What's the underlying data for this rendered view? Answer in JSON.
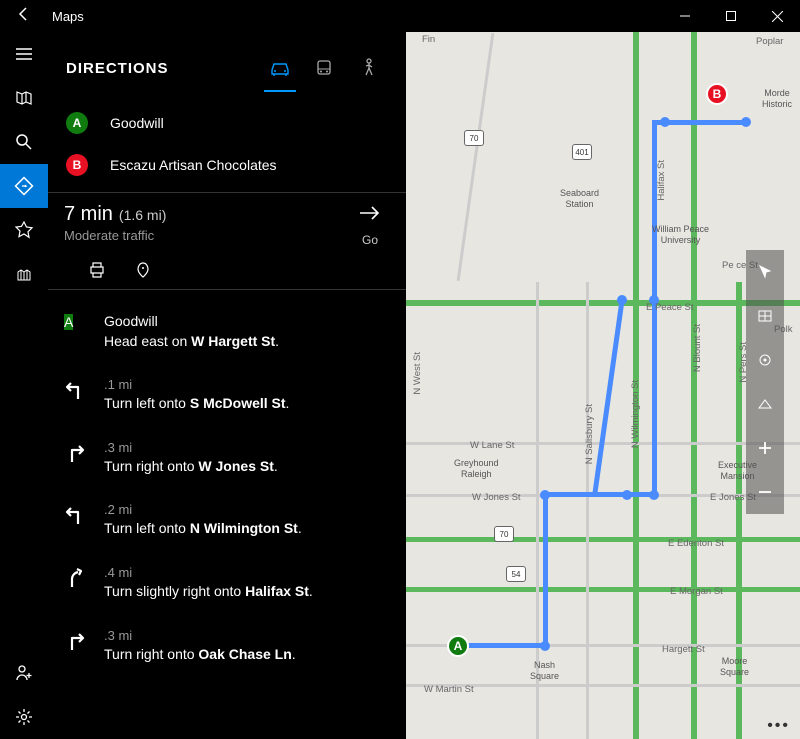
{
  "titlebar": {
    "title": "Maps"
  },
  "panel": {
    "title": "DIRECTIONS"
  },
  "modes": {
    "drive": "car-icon",
    "transit": "bus-icon",
    "walk": "walk-icon"
  },
  "endpoints": {
    "a": {
      "letter": "A",
      "label": "Goodwill"
    },
    "b": {
      "letter": "B",
      "label": "Escazu Artisan Chocolates"
    }
  },
  "summary": {
    "time": "7 min",
    "distance": "(1.6 mi)",
    "traffic": "Moderate traffic",
    "go": "Go"
  },
  "steps": [
    {
      "kind": "start",
      "title": "Goodwill",
      "instr_pre": "Head east on ",
      "road": "W Hargett St",
      "instr_post": "."
    },
    {
      "kind": "left",
      "dist": ".1 mi",
      "instr_pre": "Turn left onto ",
      "road": "S McDowell St",
      "instr_post": "."
    },
    {
      "kind": "right",
      "dist": ".3 mi",
      "instr_pre": "Turn right onto ",
      "road": "W Jones St",
      "instr_post": "."
    },
    {
      "kind": "left",
      "dist": ".2 mi",
      "instr_pre": "Turn left onto ",
      "road": "N Wilmington St",
      "instr_post": "."
    },
    {
      "kind": "slight_right",
      "dist": ".4 mi",
      "instr_pre": "Turn slightly right onto ",
      "road": "Halifax St",
      "instr_post": "."
    },
    {
      "kind": "right",
      "dist": ".3 mi",
      "instr_pre": "Turn right onto ",
      "road": "Oak Chase Ln",
      "instr_post": "."
    }
  ],
  "map": {
    "labels": {
      "fin": "Fin",
      "poplar": "Poplar",
      "morde": "Morde\nHistoric",
      "seaboard": "Seaboard\nStation",
      "wpeace_u": "William Peace\nUniversity",
      "peace_st": "Pe       ce St",
      "e_peace": "E  Peace  St",
      "polk": "Polk",
      "n_west": "N  West  St",
      "w_lane": "W  Lane  St",
      "greyhound": "Greyhound\nRaleigh",
      "w_jones": "W   Jones    St",
      "e_jones": "E  Jones St",
      "salisbury": "N Salisbury St",
      "wilmington": "N  Wilmington  St",
      "halifax": "Halifax  St",
      "n_blount": "N  Blount  St",
      "n_pers": "N  Pers       St",
      "exec": "Executive\nMansion",
      "e_edenton": "E  Edenton  St",
      "e_morgan": "E  Morgan  St",
      "hargett": "Hargett  St",
      "w_martin": "W  Martin  St",
      "nash": "Nash\nSquare",
      "moore": "Moore\nSquare",
      "r70a": "70",
      "r70b": "70",
      "r54": "54",
      "r401": "401"
    },
    "pins": {
      "a": "A",
      "b": "B"
    }
  },
  "colors": {
    "accent": "#0078D7"
  }
}
